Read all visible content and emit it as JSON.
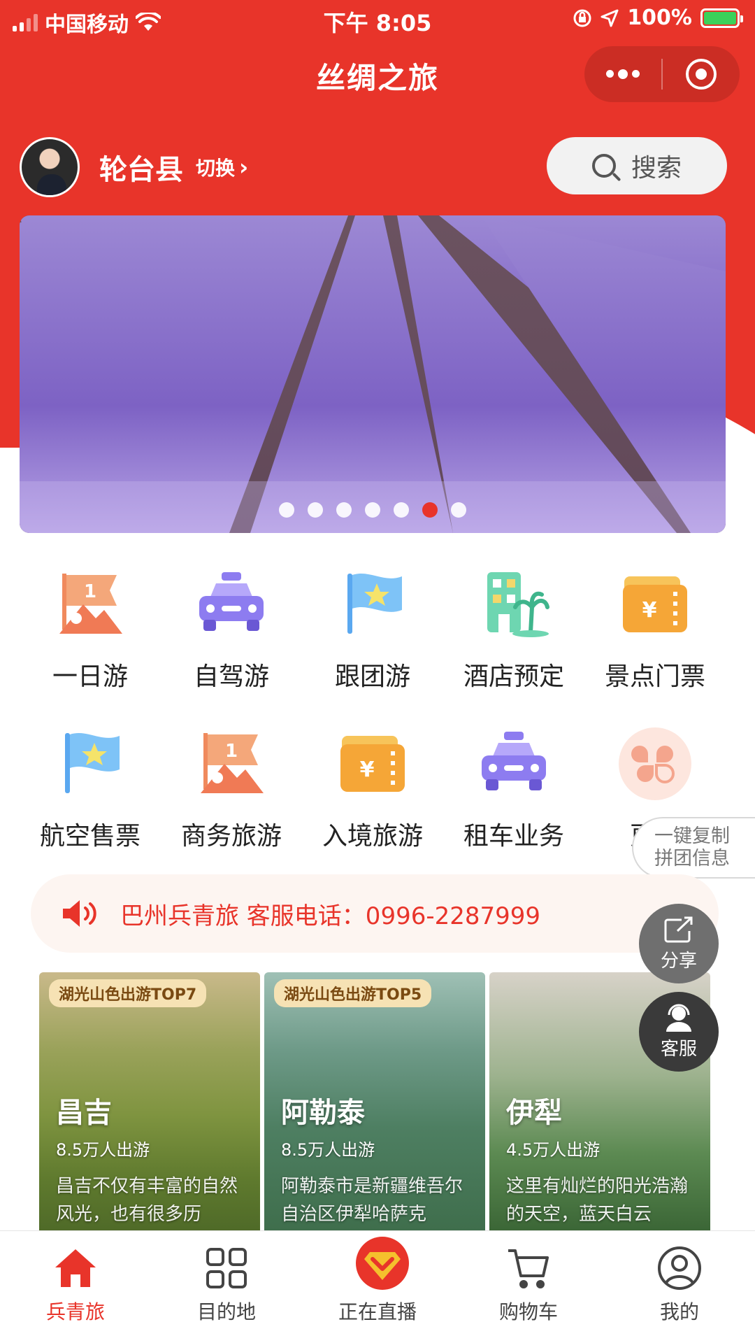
{
  "status_bar": {
    "carrier": "中国移动",
    "time": "下午 8:05",
    "battery": "100%"
  },
  "nav": {
    "title": "丝绸之旅"
  },
  "location": {
    "county": "轮台县",
    "switch_label": "切换"
  },
  "search": {
    "label": "搜索"
  },
  "banner": {
    "slide_count": 7,
    "active_index": 5
  },
  "grid": {
    "items": [
      {
        "label": "一日游",
        "icon": "day-tour-flag-icon"
      },
      {
        "label": "自驾游",
        "icon": "car-icon"
      },
      {
        "label": "跟团游",
        "icon": "group-tour-flag-icon"
      },
      {
        "label": "酒店预定",
        "icon": "hotel-icon"
      },
      {
        "label": "景点门票",
        "icon": "ticket-wallet-icon"
      },
      {
        "label": "航空售票",
        "icon": "flight-flag-icon"
      },
      {
        "label": "商务旅游",
        "icon": "business-tour-flag-icon"
      },
      {
        "label": "入境旅游",
        "icon": "inbound-wallet-icon"
      },
      {
        "label": "租车业务",
        "icon": "rental-car-icon"
      },
      {
        "label": "更多",
        "icon": "more-clover-icon"
      }
    ]
  },
  "copy_tab": {
    "line1": "一键复制",
    "line2": "拼团信息"
  },
  "notice": {
    "text": "巴州兵青旅 客服电话：0996-2287999"
  },
  "fabs": {
    "share": "分享",
    "service": "客服"
  },
  "cards": [
    {
      "tag": "湖光山色出游TOP7",
      "name": "昌吉",
      "count": "8.5万人出游",
      "desc": "昌吉不仅有丰富的自然风光，也有很多历"
    },
    {
      "tag": "湖光山色出游TOP5",
      "name": "阿勒泰",
      "count": "8.5万人出游",
      "desc": "阿勒泰市是新疆维吾尔自治区伊犁哈萨克"
    },
    {
      "tag": "",
      "name": "伊犁",
      "count": "4.5万人出游",
      "desc": "这里有灿烂的阳光浩瀚的天空，蓝天白云"
    }
  ],
  "tabbar": {
    "items": [
      {
        "label": "兵青旅",
        "icon": "home-icon",
        "active": true
      },
      {
        "label": "目的地",
        "icon": "grid-icon",
        "active": false
      },
      {
        "label": "正在直播",
        "icon": "live-icon",
        "active": false
      },
      {
        "label": "购物车",
        "icon": "cart-icon",
        "active": false
      },
      {
        "label": "我的",
        "icon": "profile-icon",
        "active": false
      }
    ]
  },
  "colors": {
    "brand_red": "#e8342a",
    "notice_bg": "#fdf5f1"
  }
}
